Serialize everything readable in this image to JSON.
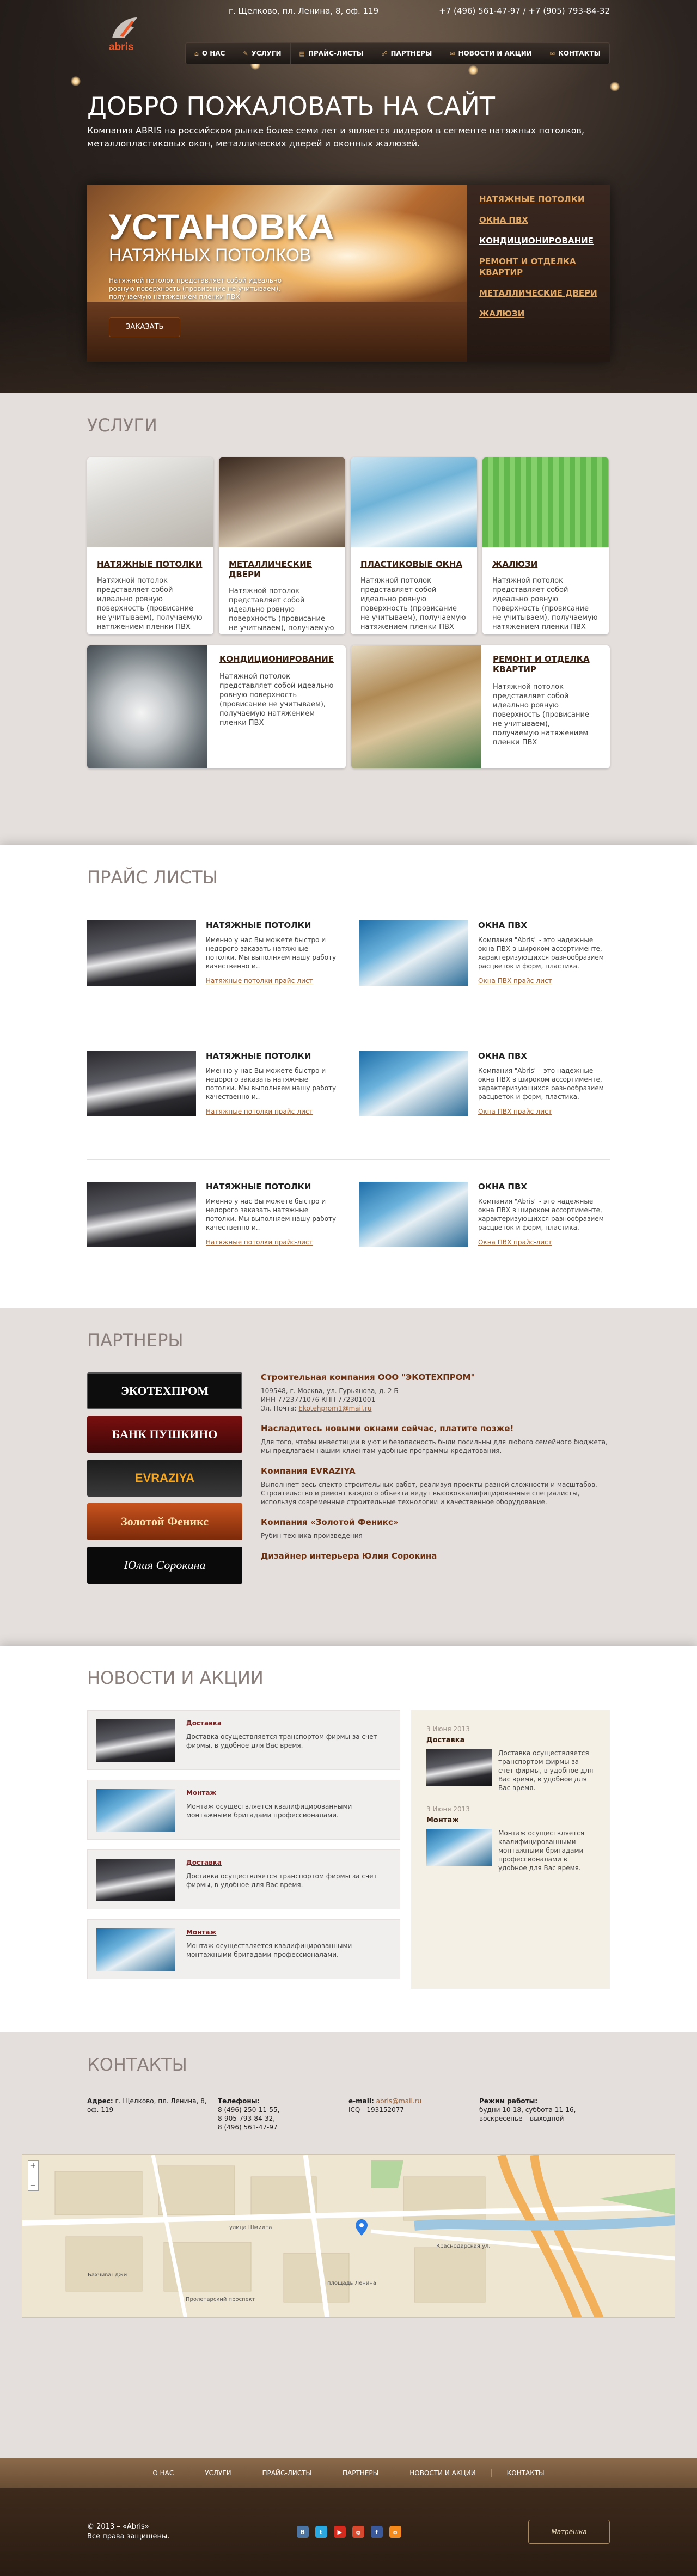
{
  "header": {
    "address": "г. Щелково, пл. Ленина, 8, оф. 119",
    "phones": "+7 (496) 561-47-97 / +7 (905) 793-84-32",
    "logo_text": "abris"
  },
  "nav": {
    "items": [
      {
        "label": "О НАС",
        "icon": "home-icon"
      },
      {
        "label": "УСЛУГИ",
        "icon": "tools-icon"
      },
      {
        "label": "ПРАЙС-ЛИСТЫ",
        "icon": "document-icon"
      },
      {
        "label": "ПАРТНЕРЫ",
        "icon": "handshake-icon"
      },
      {
        "label": "НОВОСТИ И АКЦИИ",
        "icon": "news-icon"
      },
      {
        "label": "КОНТАКТЫ",
        "icon": "mail-icon"
      }
    ]
  },
  "hero": {
    "title": "ДОБРО ПОЖАЛОВАТЬ НА САЙТ",
    "intro": "Компания ABRIS на российском рынке более семи лет и является лидером в сегменте натяжных потолков, металлопластиковых окон, металлических дверей и оконных жалюзей."
  },
  "slider": {
    "title1": "УСТАНОВКА",
    "title2": "НАТЯЖНЫХ ПОТОЛКОВ",
    "text": "Натяжной потолок представляет собой идеально ровную поверхность (провисание не учитываем), получаемую натяжением пленки ПВХ",
    "button": "ЗАКАЗАТЬ",
    "menu": [
      "НАТЯЖНЫЕ ПОТОЛКИ",
      "ОКНА ПВХ",
      "КОНДИЦИОНИРОВАНИЕ",
      "РЕМОНТ И ОТДЕЛКА КВАРТИР",
      "МЕТАЛЛИЧЕСКИЕ ДВЕРИ",
      "ЖАЛЮЗИ"
    ]
  },
  "services": {
    "title": "УСЛУГИ",
    "items": [
      {
        "name": "НАТЯЖНЫЕ ПОТОЛКИ",
        "text": "Натяжной потолок представляет собой идеально ровную поверхность (провисание не учитываем), получаемую натяжением пленки ПВХ"
      },
      {
        "name": "МЕТАЛЛИЧЕСКИЕ ДВЕРИ",
        "text": "Натяжной потолок представляет собой идеально ровную поверхность (провисание не учитываем), получаемую натяжением пленки ПВХ"
      },
      {
        "name": "ПЛАСТИКОВЫЕ ОКНА",
        "text": "Натяжной потолок представляет собой идеально ровную поверхность (провисание не учитываем), получаемую натяжением пленки ПВХ"
      },
      {
        "name": "ЖАЛЮЗИ",
        "text": "Натяжной потолок представляет собой идеально ровную поверхность (провисание не учитываем), получаемую натяжением пленки ПВХ"
      },
      {
        "name": "КОНДИЦИОНИРОВАНИЕ",
        "text": "Натяжной потолок представляет собой идеально ровную поверхность (провисание не учитываем), получаемую натяжением пленки ПВХ"
      },
      {
        "name": "РЕМОНТ И ОТДЕЛКА КВАРТИР",
        "text": "Натяжной потолок представляет собой идеально ровную поверхность (провисание не учитываем), получаемую натяжением пленки ПВХ"
      }
    ]
  },
  "price": {
    "title": "ПРАЙС ЛИСТЫ",
    "left": {
      "name": "НАТЯЖНЫЕ ПОТОЛКИ",
      "text": "Именно у нас Вы можете быстро и недорого заказать натяжные потолки. Мы выполняем нашу работу качественно и..",
      "link": "Натяжные потолки прайс-лист"
    },
    "right": {
      "name": "ОКНА ПВХ",
      "text": "Компания \"Abris\" - это надежные окна ПВХ в широком ассортименте, характеризующихся разнообразием расцветок и форм, пластика.",
      "link": "Окна ПВХ прайс-лист"
    }
  },
  "partners": {
    "title": "ПАРТНЕРЫ",
    "logos": [
      "ЭКОТЕХПРОМ",
      "БАНК ПУШКИНО",
      "EVRAZIYA",
      "Золотой Феникс",
      "Юлия Сорокина"
    ],
    "items": [
      {
        "name": "Строительная компания ООО \"ЭКОТЕХПРОМ\"",
        "line1": "109548, г. Москва, ул. Гурьянова, д. 2 Б",
        "line2": "ИНН 7723771076 КПП 772301001",
        "mail_label": "Эл. Почта:",
        "mail": "Ekotehprom1@mail.ru"
      },
      {
        "name": "Насладитесь новыми окнами сейчас, платите позже!",
        "text": "Для того, чтобы инвестиции в уют и безопасность были посильны для любого семейного бюджета, мы предлагаем нашим клиентам удобные программы кредитования."
      },
      {
        "name": "Компания EVRAZIYA",
        "text": "Выполняет весь спектр строительных работ, реализуя проекты разной сложности и масштабов. Строительство и ремонт каждого объекта ведут высококвалифицированные специалисты, используя современные строительные технологии и качественное оборудование."
      },
      {
        "name": "Компания «Золотой Феникс»",
        "text": "Рубин техника произведения"
      },
      {
        "name": "Дизайнер интерьера Юлия Сорокина",
        "text": ""
      }
    ]
  },
  "news": {
    "title": "НОВОСТИ И АКЦИИ",
    "items": [
      {
        "title": "Доставка",
        "text": "Доставка осуществляется транспортом фирмы за счет фирмы, в удобное для Вас время."
      },
      {
        "title": "Монтаж",
        "text": "Монтаж осуществляется квалифицированными монтажными бригадами профессионалами."
      },
      {
        "title": "Доставка",
        "text": "Доставка осуществляется транспортом фирмы за счет фирмы, в удобное для Вас время."
      },
      {
        "title": "Монтаж",
        "text": "Монтаж осуществляется квалифицированными монтажными бригадами профессионалами."
      }
    ],
    "side": [
      {
        "date": "3 Июня 2013",
        "title": "Доставка",
        "text": "Доставка осуществляется транспортом фирмы за счет фирмы, в удобное для Вас время, в удобное для Вас время."
      },
      {
        "date": "3 Июня 2013",
        "title": "Монтаж",
        "text": "Монтаж осуществляется квалифицированными монтажными бригадами профессионалами в удобное для Вас время."
      }
    ]
  },
  "contacts": {
    "title": "КОНТАКТЫ",
    "address_label": "Адрес:",
    "address": "г. Щелково, пл. Ленина, 8, оф. 119",
    "phones_label": "Телефоны:",
    "phones": [
      "8 (496) 250-11-55,",
      "8-905-793-84-32,",
      "8 (496) 561-47-97"
    ],
    "email_label": "e-mail:",
    "email": "abris@mail.ru",
    "icq": "ICQ - 193152077",
    "hours_label": "Режим работы:",
    "hours": "будни 10-18, суббота 11-16, воскресенье – выходной"
  },
  "map": {
    "streets": [
      "улица Шмидта",
      "Пролетарский проспект",
      "Краснодарская ул.",
      "площадь Ленина",
      "Бахчиванджи"
    ]
  },
  "footer": {
    "nav": [
      "О НАС",
      "УСЛУГИ",
      "ПРАЙС-ЛИСТЫ",
      "ПАРТНЕРЫ",
      "НОВОСТИ И АКЦИИ",
      "КОНТАКТЫ"
    ],
    "copyright": "© 2013 – «Abris»",
    "rights": "Все права защищены.",
    "developer": "Матрёшка",
    "social": [
      {
        "icon": "vk-icon",
        "glyph": "B",
        "color": "#4c75a3"
      },
      {
        "icon": "twitter-icon",
        "glyph": "t",
        "color": "#2ca8e0"
      },
      {
        "icon": "youtube-icon",
        "glyph": "▶",
        "color": "#d52b1e"
      },
      {
        "icon": "google-plus-icon",
        "glyph": "g",
        "color": "#d6492e"
      },
      {
        "icon": "facebook-icon",
        "glyph": "f",
        "color": "#3b5998"
      },
      {
        "icon": "odnoklassniki-icon",
        "glyph": "o",
        "color": "#f38a1d"
      }
    ]
  }
}
